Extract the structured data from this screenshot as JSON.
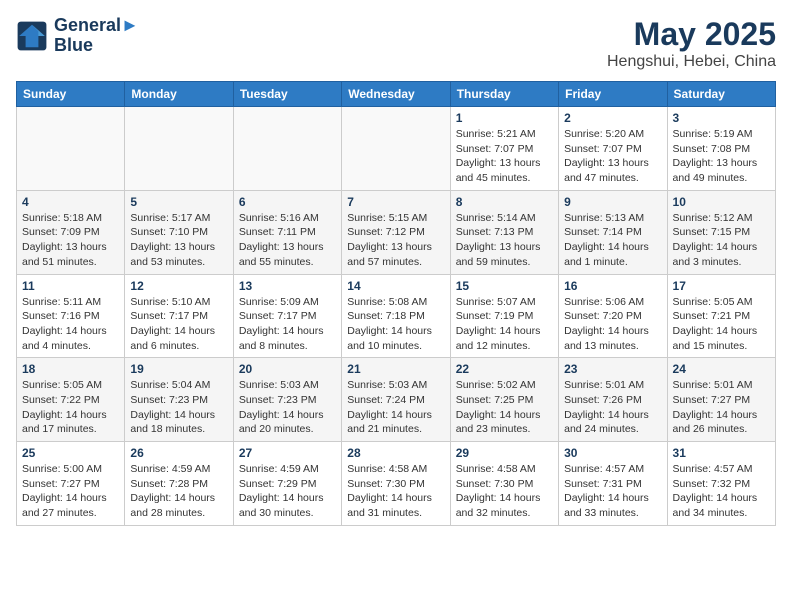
{
  "logo": {
    "line1": "General",
    "line2": "Blue"
  },
  "title": "May 2025",
  "subtitle": "Hengshui, Hebei, China",
  "days_of_week": [
    "Sunday",
    "Monday",
    "Tuesday",
    "Wednesday",
    "Thursday",
    "Friday",
    "Saturday"
  ],
  "weeks": [
    [
      {
        "day": "",
        "detail": ""
      },
      {
        "day": "",
        "detail": ""
      },
      {
        "day": "",
        "detail": ""
      },
      {
        "day": "",
        "detail": ""
      },
      {
        "day": "1",
        "detail": "Sunrise: 5:21 AM\nSunset: 7:07 PM\nDaylight: 13 hours\nand 45 minutes."
      },
      {
        "day": "2",
        "detail": "Sunrise: 5:20 AM\nSunset: 7:07 PM\nDaylight: 13 hours\nand 47 minutes."
      },
      {
        "day": "3",
        "detail": "Sunrise: 5:19 AM\nSunset: 7:08 PM\nDaylight: 13 hours\nand 49 minutes."
      }
    ],
    [
      {
        "day": "4",
        "detail": "Sunrise: 5:18 AM\nSunset: 7:09 PM\nDaylight: 13 hours\nand 51 minutes."
      },
      {
        "day": "5",
        "detail": "Sunrise: 5:17 AM\nSunset: 7:10 PM\nDaylight: 13 hours\nand 53 minutes."
      },
      {
        "day": "6",
        "detail": "Sunrise: 5:16 AM\nSunset: 7:11 PM\nDaylight: 13 hours\nand 55 minutes."
      },
      {
        "day": "7",
        "detail": "Sunrise: 5:15 AM\nSunset: 7:12 PM\nDaylight: 13 hours\nand 57 minutes."
      },
      {
        "day": "8",
        "detail": "Sunrise: 5:14 AM\nSunset: 7:13 PM\nDaylight: 13 hours\nand 59 minutes."
      },
      {
        "day": "9",
        "detail": "Sunrise: 5:13 AM\nSunset: 7:14 PM\nDaylight: 14 hours\nand 1 minute."
      },
      {
        "day": "10",
        "detail": "Sunrise: 5:12 AM\nSunset: 7:15 PM\nDaylight: 14 hours\nand 3 minutes."
      }
    ],
    [
      {
        "day": "11",
        "detail": "Sunrise: 5:11 AM\nSunset: 7:16 PM\nDaylight: 14 hours\nand 4 minutes."
      },
      {
        "day": "12",
        "detail": "Sunrise: 5:10 AM\nSunset: 7:17 PM\nDaylight: 14 hours\nand 6 minutes."
      },
      {
        "day": "13",
        "detail": "Sunrise: 5:09 AM\nSunset: 7:17 PM\nDaylight: 14 hours\nand 8 minutes."
      },
      {
        "day": "14",
        "detail": "Sunrise: 5:08 AM\nSunset: 7:18 PM\nDaylight: 14 hours\nand 10 minutes."
      },
      {
        "day": "15",
        "detail": "Sunrise: 5:07 AM\nSunset: 7:19 PM\nDaylight: 14 hours\nand 12 minutes."
      },
      {
        "day": "16",
        "detail": "Sunrise: 5:06 AM\nSunset: 7:20 PM\nDaylight: 14 hours\nand 13 minutes."
      },
      {
        "day": "17",
        "detail": "Sunrise: 5:05 AM\nSunset: 7:21 PM\nDaylight: 14 hours\nand 15 minutes."
      }
    ],
    [
      {
        "day": "18",
        "detail": "Sunrise: 5:05 AM\nSunset: 7:22 PM\nDaylight: 14 hours\nand 17 minutes."
      },
      {
        "day": "19",
        "detail": "Sunrise: 5:04 AM\nSunset: 7:23 PM\nDaylight: 14 hours\nand 18 minutes."
      },
      {
        "day": "20",
        "detail": "Sunrise: 5:03 AM\nSunset: 7:23 PM\nDaylight: 14 hours\nand 20 minutes."
      },
      {
        "day": "21",
        "detail": "Sunrise: 5:03 AM\nSunset: 7:24 PM\nDaylight: 14 hours\nand 21 minutes."
      },
      {
        "day": "22",
        "detail": "Sunrise: 5:02 AM\nSunset: 7:25 PM\nDaylight: 14 hours\nand 23 minutes."
      },
      {
        "day": "23",
        "detail": "Sunrise: 5:01 AM\nSunset: 7:26 PM\nDaylight: 14 hours\nand 24 minutes."
      },
      {
        "day": "24",
        "detail": "Sunrise: 5:01 AM\nSunset: 7:27 PM\nDaylight: 14 hours\nand 26 minutes."
      }
    ],
    [
      {
        "day": "25",
        "detail": "Sunrise: 5:00 AM\nSunset: 7:27 PM\nDaylight: 14 hours\nand 27 minutes."
      },
      {
        "day": "26",
        "detail": "Sunrise: 4:59 AM\nSunset: 7:28 PM\nDaylight: 14 hours\nand 28 minutes."
      },
      {
        "day": "27",
        "detail": "Sunrise: 4:59 AM\nSunset: 7:29 PM\nDaylight: 14 hours\nand 30 minutes."
      },
      {
        "day": "28",
        "detail": "Sunrise: 4:58 AM\nSunset: 7:30 PM\nDaylight: 14 hours\nand 31 minutes."
      },
      {
        "day": "29",
        "detail": "Sunrise: 4:58 AM\nSunset: 7:30 PM\nDaylight: 14 hours\nand 32 minutes."
      },
      {
        "day": "30",
        "detail": "Sunrise: 4:57 AM\nSunset: 7:31 PM\nDaylight: 14 hours\nand 33 minutes."
      },
      {
        "day": "31",
        "detail": "Sunrise: 4:57 AM\nSunset: 7:32 PM\nDaylight: 14 hours\nand 34 minutes."
      }
    ]
  ]
}
